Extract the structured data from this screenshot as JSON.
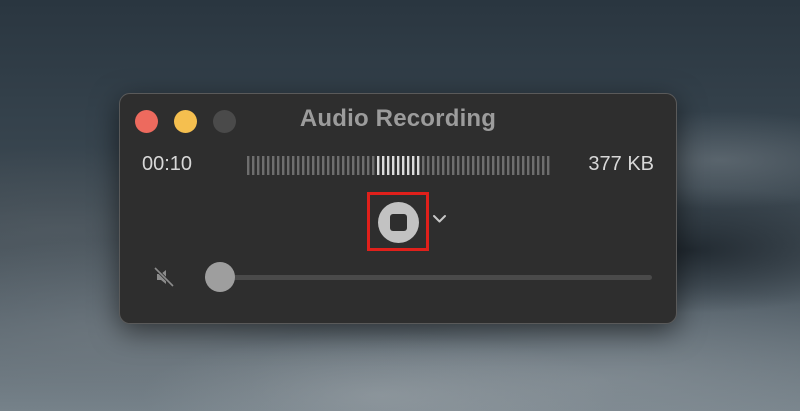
{
  "window": {
    "title": "Audio Recording"
  },
  "recording": {
    "elapsed_time": "00:10",
    "file_size": "377 KB"
  },
  "controls": {
    "stop_icon": "stop-icon",
    "options_icon": "chevron-down-icon",
    "mute_icon": "speaker-muted-icon",
    "volume_level": 0.0,
    "highlight_color": "#e0201b"
  },
  "colors": {
    "close": "#ed6a5e",
    "minimize": "#f5bf4f",
    "zoom_disabled": "#4a4a4a"
  }
}
